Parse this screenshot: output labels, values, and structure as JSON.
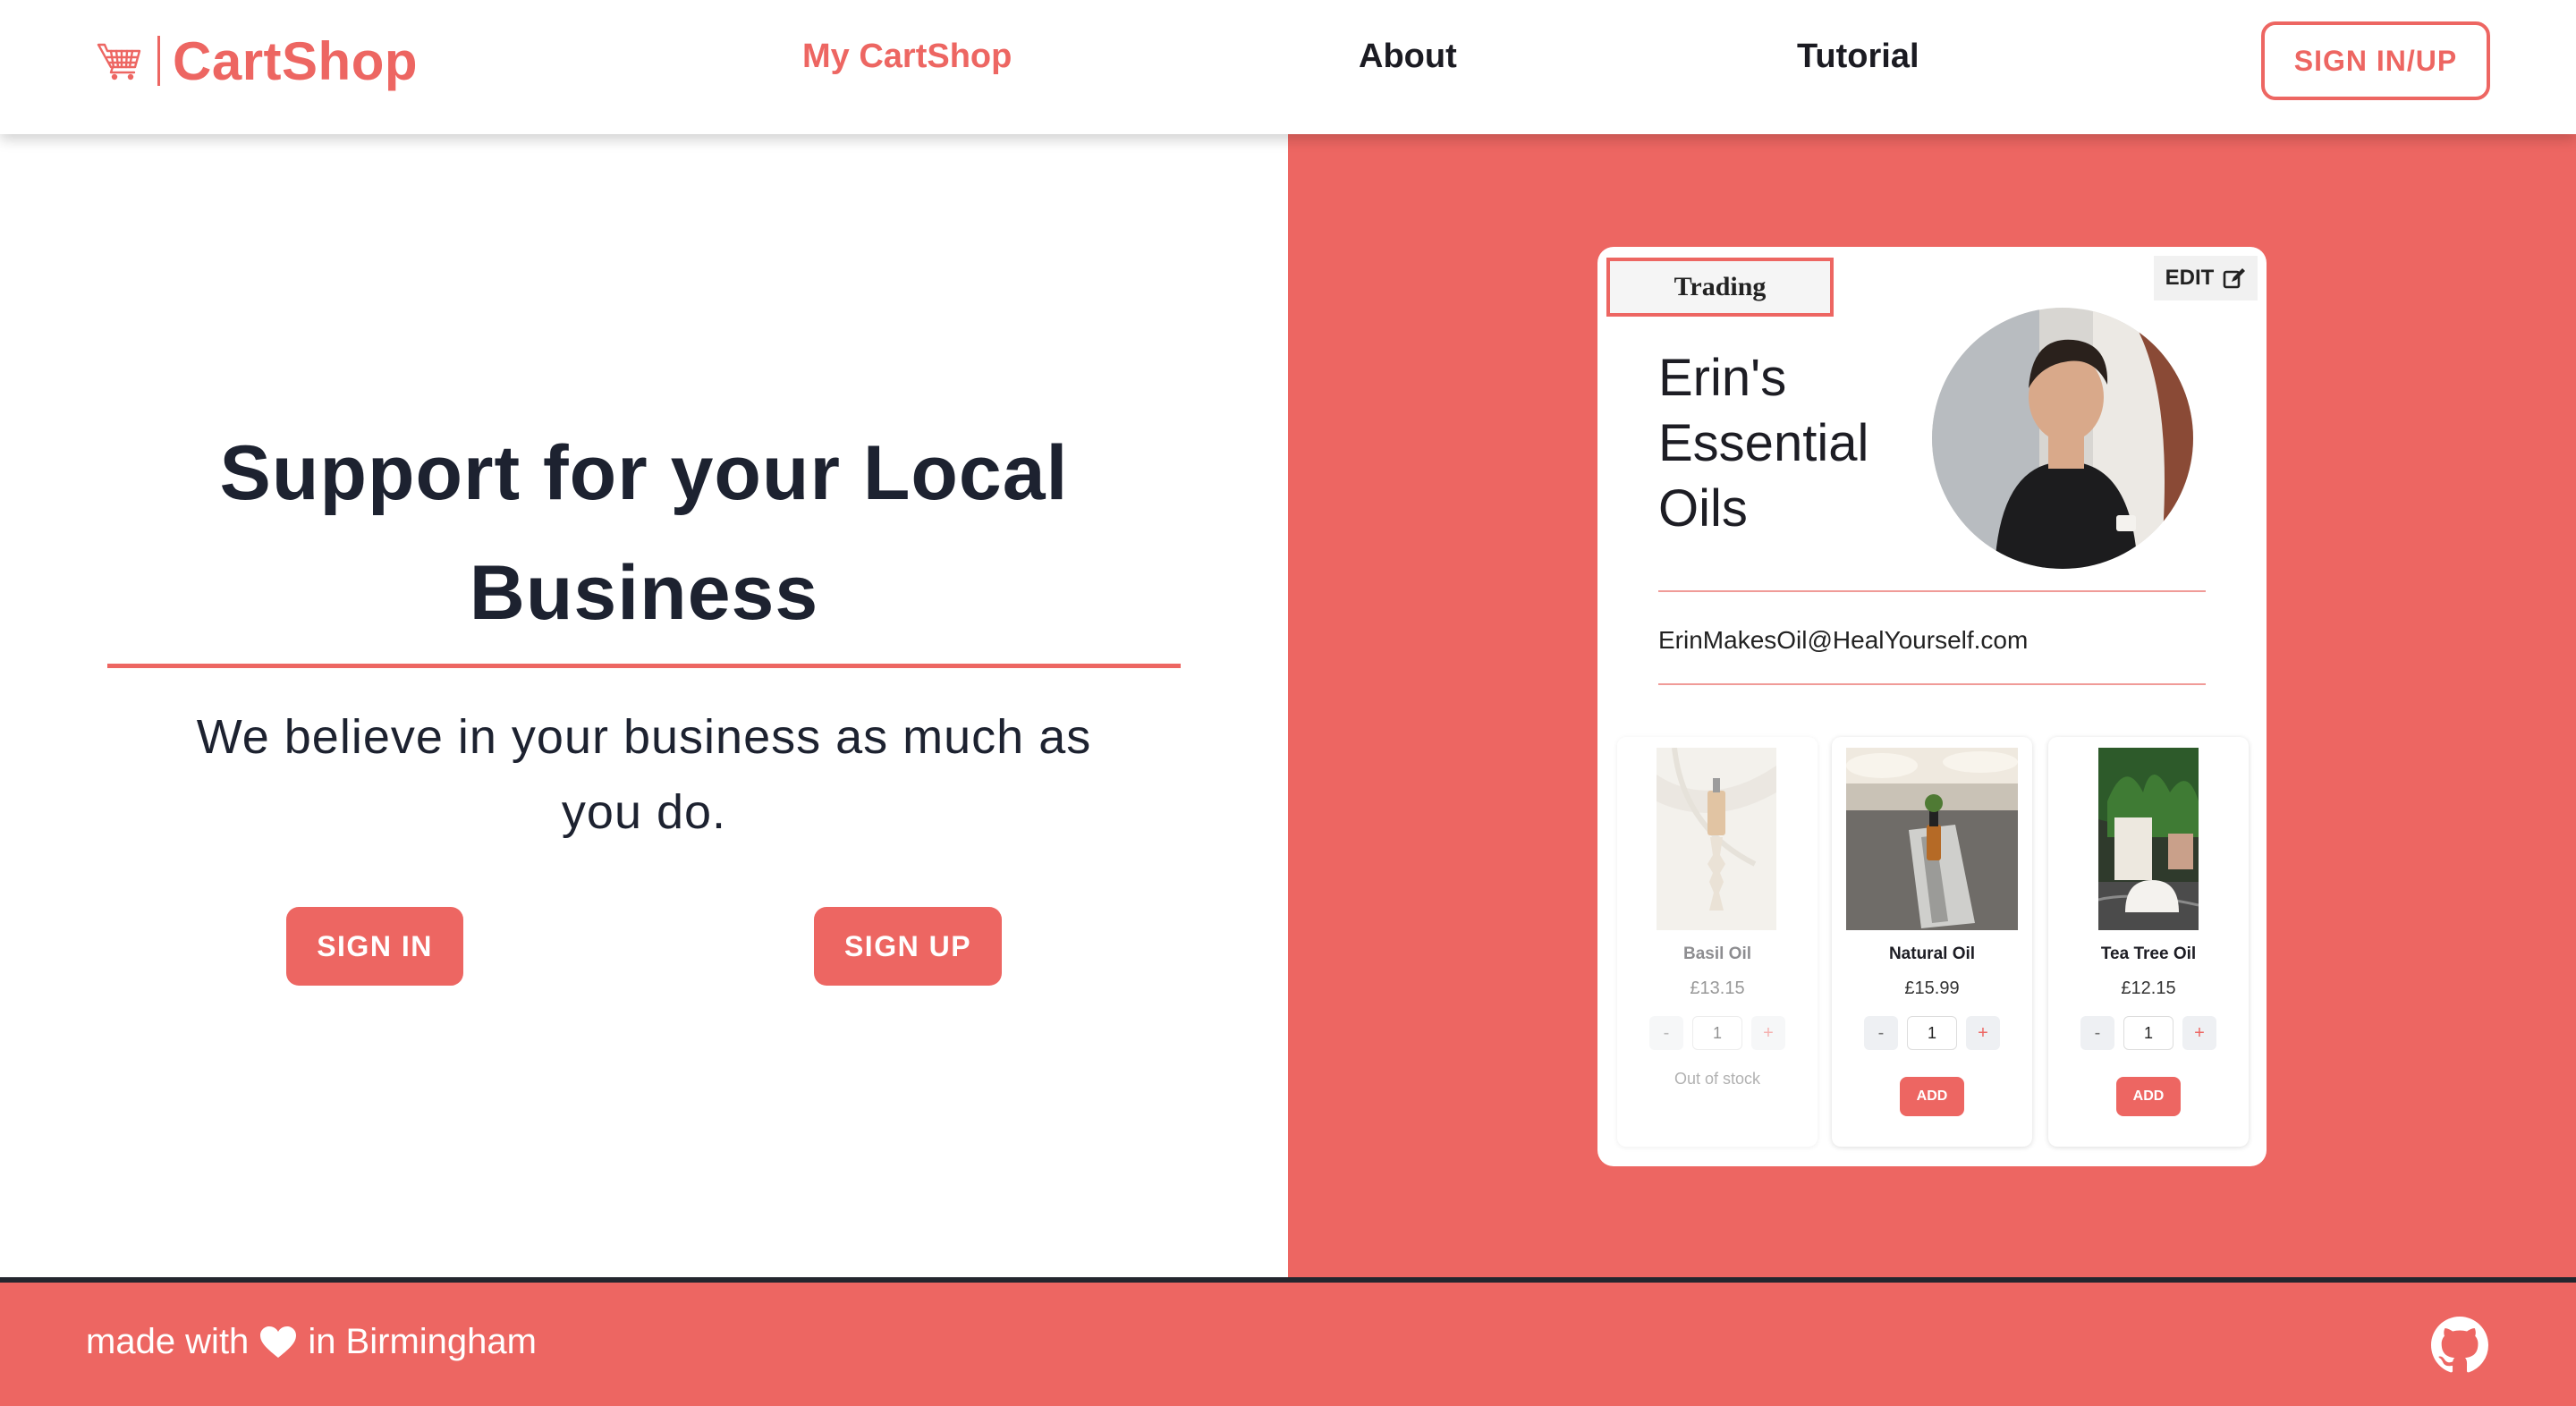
{
  "header": {
    "brand": "CartShop",
    "nav": {
      "my_cartshop": "My CartShop",
      "about": "About",
      "tutorial": "Tutorial"
    },
    "signin_signup": "SIGN IN/UP"
  },
  "hero": {
    "title": "Support for your Local Business",
    "subtitle": "We believe in your business as much as you do.",
    "sign_in": "SIGN IN",
    "sign_up": "SIGN UP"
  },
  "shop_card": {
    "status": "Trading",
    "edit_label": "EDIT",
    "shop_name": "Erin's Essential Oils",
    "email": "ErinMakesOil@HealYourself.com",
    "products": [
      {
        "name": "Basil Oil",
        "price": "£13.15",
        "quantity": "1",
        "minus": "-",
        "plus": "+",
        "status": "Out of stock",
        "in_stock": false
      },
      {
        "name": "Natural Oil",
        "price": "£15.99",
        "quantity": "1",
        "minus": "-",
        "plus": "+",
        "add_label": "ADD",
        "in_stock": true
      },
      {
        "name": "Tea Tree Oil",
        "price": "£12.15",
        "quantity": "1",
        "minus": "-",
        "plus": "+",
        "add_label": "ADD",
        "in_stock": true
      }
    ]
  },
  "footer": {
    "made_with": "made with",
    "in_city": "in Birmingham"
  },
  "icons": {
    "logo": "shopping-cart-icon",
    "edit": "edit-icon",
    "heart": "heart-icon",
    "github": "github-icon"
  },
  "colors": {
    "accent": "#ed6662",
    "text_dark": "#1d2230",
    "footer_divider": "#23262e"
  }
}
